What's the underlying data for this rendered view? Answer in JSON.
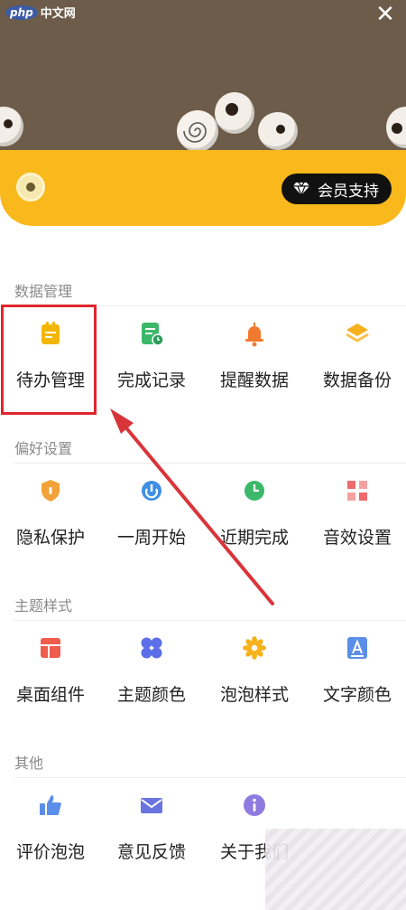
{
  "watermark": {
    "logo": "php",
    "text": "中文网"
  },
  "close_glyph": "✕",
  "member": {
    "vip_label": "会员支持"
  },
  "sections": [
    {
      "title": "数据管理",
      "items": [
        {
          "label": "待办管理",
          "icon": "todo-icon",
          "color": "#f2b705"
        },
        {
          "label": "完成记录",
          "icon": "record-icon",
          "color": "#3bb86a"
        },
        {
          "label": "提醒数据",
          "icon": "bell-icon",
          "color": "#f27a2e"
        },
        {
          "label": "数据备份",
          "icon": "layers-icon",
          "color": "#f6b11c"
        }
      ]
    },
    {
      "title": "偏好设置",
      "items": [
        {
          "label": "隐私保护",
          "icon": "shield-icon",
          "color": "#f3a23a"
        },
        {
          "label": "一周开始",
          "icon": "calendar-start-icon",
          "color": "#3f8fe3"
        },
        {
          "label": "近期完成",
          "icon": "clock-icon",
          "color": "#3bb86a"
        },
        {
          "label": "音效设置",
          "icon": "sound-icon",
          "color": "#f06a6a"
        }
      ]
    },
    {
      "title": "主题样式",
      "items": [
        {
          "label": "桌面组件",
          "icon": "widget-icon",
          "color": "#ef5b4c"
        },
        {
          "label": "主题颜色",
          "icon": "palette-icon",
          "color": "#5b6fe8"
        },
        {
          "label": "泡泡样式",
          "icon": "bubble-style-icon",
          "color": "#f6b11c"
        },
        {
          "label": "文字颜色",
          "icon": "text-color-icon",
          "color": "#5b8ee8"
        }
      ]
    },
    {
      "title": "其他",
      "items": [
        {
          "label": "评价泡泡",
          "icon": "thumbs-up-icon",
          "color": "#5b8ee8"
        },
        {
          "label": "意见反馈",
          "icon": "mail-icon",
          "color": "#6a73e0"
        },
        {
          "label": "关于我们",
          "icon": "info-icon",
          "color": "#8e7be0"
        }
      ]
    }
  ]
}
